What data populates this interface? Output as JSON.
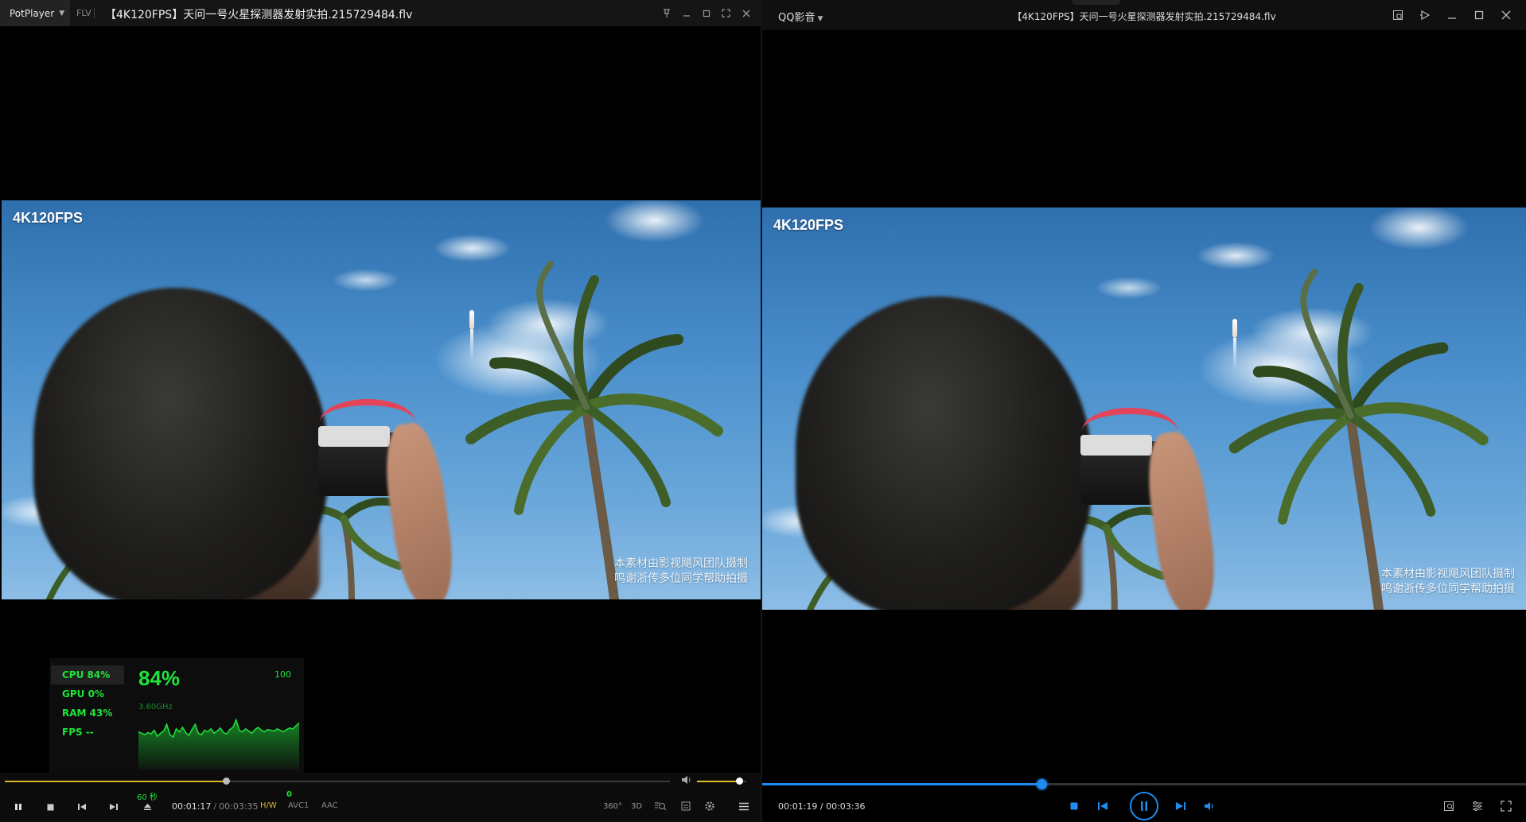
{
  "pot": {
    "app_name": "PotPlayer",
    "format": "FLV",
    "filename": "【4K120FPS】天问一号火星探测器发射实拍.215729484.flv",
    "video": {
      "label_top_left": "4K120FPS",
      "credit_line1": "本素材由影视飓风团队摄制",
      "credit_line2": "鸣谢浙传多位同学帮助拍摄"
    },
    "perf": {
      "cpu": "CPU  84%",
      "gpu": "GPU   0%",
      "ram": "RAM  43%",
      "fps": "FPS --",
      "big": "84%",
      "max": "100",
      "freq": "3.60GHz",
      "graph_values": [
        42,
        40,
        38,
        41,
        39,
        44,
        36,
        40,
        43,
        52,
        38,
        35,
        46,
        42,
        48,
        41,
        37,
        45,
        52,
        40,
        38,
        44,
        42,
        46,
        40,
        43,
        47,
        41,
        39,
        45,
        48,
        58,
        44,
        42,
        46,
        43,
        40,
        45,
        48,
        44,
        42,
        45,
        44,
        43,
        46,
        44,
        42,
        45,
        47,
        46,
        50,
        54
      ]
    },
    "seek_progress": 0.333,
    "volume": 0.85,
    "seconds_label": "60 秒",
    "counter": "0",
    "time_current": "00:01:17",
    "time_sep": "/",
    "time_total": "00:03:35",
    "tag_hw": "H/W",
    "tag_video": "AVC1",
    "tag_audio": "AAC",
    "btn_360": "360°",
    "btn_3d": "3D"
  },
  "qq": {
    "app_name": "QQ影音",
    "filename": "【4K120FPS】天问一号火星探测器发射实拍.215729484.flv",
    "video": {
      "label_top_left": "4K120FPS",
      "credit_line1": "本素材由影视飓风团队摄制",
      "credit_line2": "鸣谢浙传多位同学帮助拍摄"
    },
    "seek_progress": 0.366,
    "time": "00:01:19 / 00:03:36"
  },
  "colors": {
    "pot_accent": "#d8b72a",
    "perf_green": "#1fe43a",
    "qq_accent": "#1e8cf0"
  }
}
